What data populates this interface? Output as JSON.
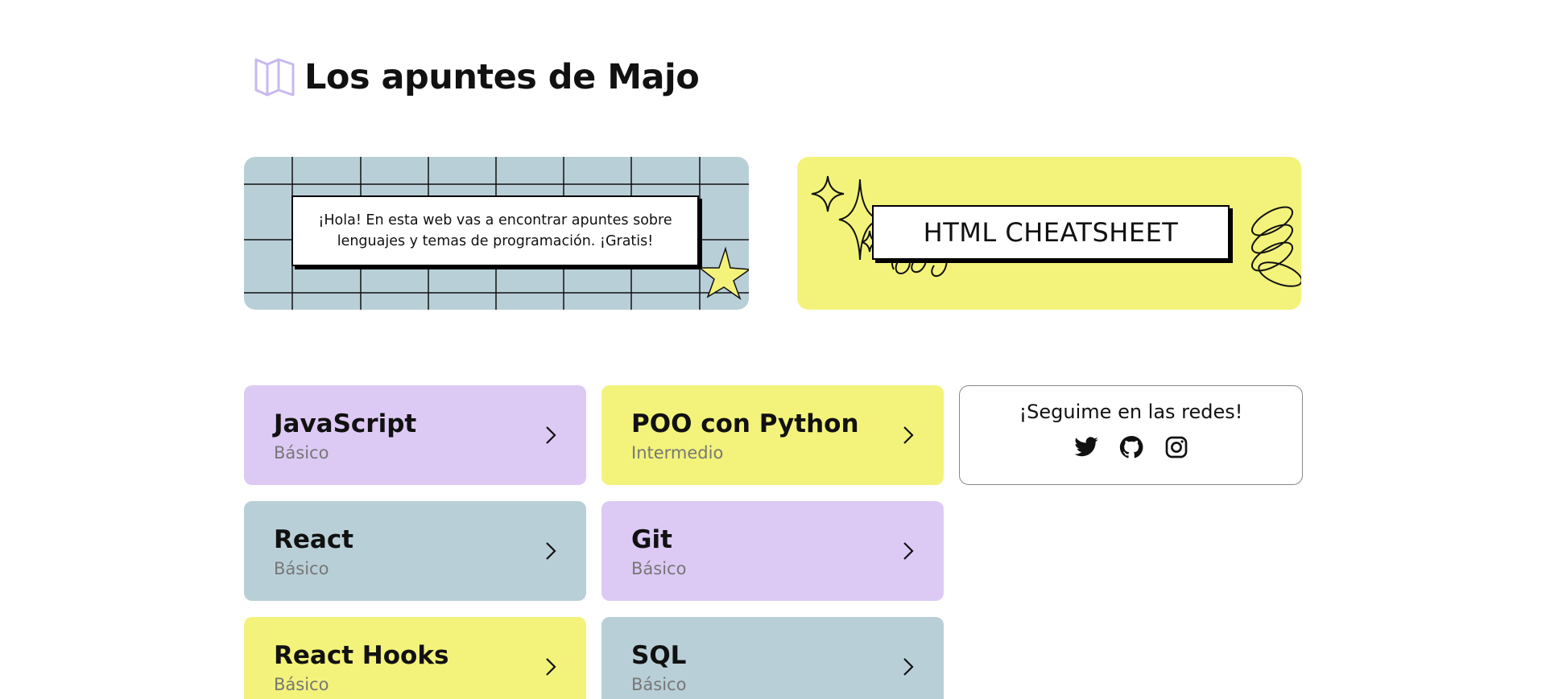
{
  "header": {
    "title": "Los apuntes de Majo",
    "logo_icon": "map-icon"
  },
  "banners": {
    "intro_text": "¡Hola! En esta web vas a encontrar apuntes sobre lenguajes y temas de programación. ¡Gratis!",
    "cheatsheet_label": "HTML CHEATSHEET"
  },
  "courses": [
    {
      "title": "JavaScript",
      "level": "Básico",
      "color": "#dccaf5"
    },
    {
      "title": "POO con Python",
      "level": "Intermedio",
      "color": "#f3f37b"
    },
    {
      "title": "React",
      "level": "Básico",
      "color": "#b9cfd8"
    },
    {
      "title": "Git",
      "level": "Básico",
      "color": "#dccaf5"
    },
    {
      "title": "React Hooks",
      "level": "Básico",
      "color": "#f3f37b"
    },
    {
      "title": "SQL",
      "level": "Básico",
      "color": "#b9cfd8"
    }
  ],
  "social": {
    "title": "¡Seguime en las redes!",
    "icons": [
      "twitter-icon",
      "github-icon",
      "instagram-icon"
    ]
  },
  "colors": {
    "purple": "#dccaf5",
    "yellow": "#f3f37b",
    "blue": "#b9cfd8",
    "logo": "#c9b8f0"
  }
}
